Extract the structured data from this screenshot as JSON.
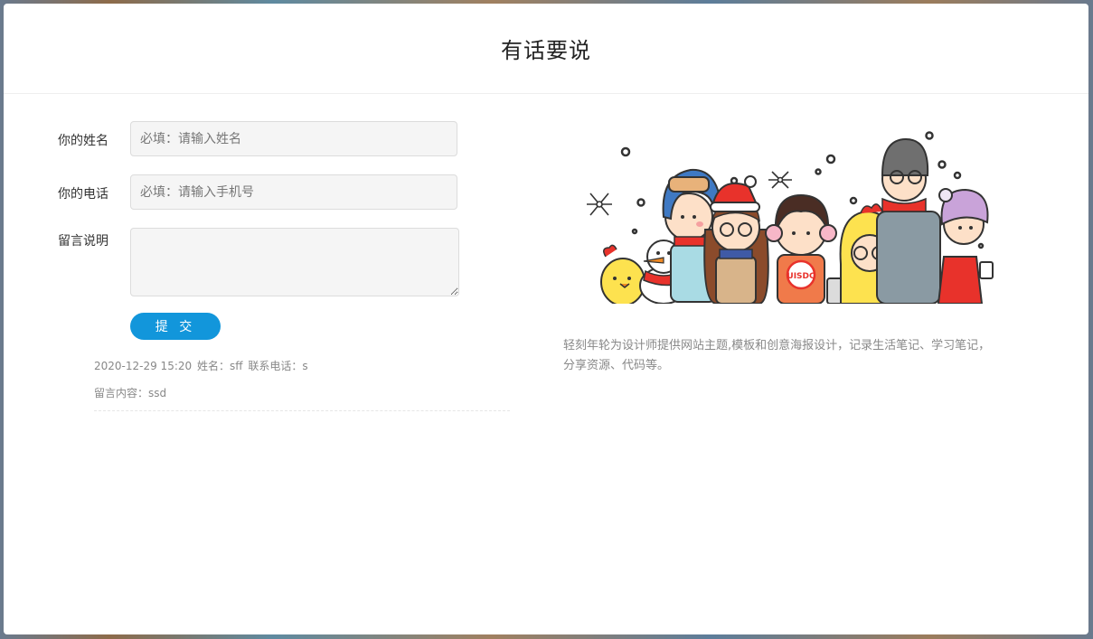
{
  "modal": {
    "title": "有话要说"
  },
  "form": {
    "name": {
      "label": "你的姓名",
      "placeholder": "必填：请输入姓名",
      "value": ""
    },
    "phone": {
      "label": "你的电话",
      "placeholder": "必填：请输入手机号",
      "value": ""
    },
    "message": {
      "label": "留言说明",
      "value": ""
    },
    "submit_label": "提 交"
  },
  "messages": [
    {
      "datetime": "2020-12-29 15:20",
      "name_label": "姓名：",
      "name": "sff",
      "phone_label": "联系电话：",
      "phone": "s",
      "content_label": "留言内容：",
      "content": "ssd"
    }
  ],
  "description": "轻刻年轮为设计师提供网站主题,模板和创意海报设计，记录生活笔记、学习笔记，分享资源、代码等。",
  "illustration": {
    "badge_text": "UISDC"
  },
  "colors": {
    "accent": "#1296db",
    "input_bg": "#f5f5f5",
    "text_muted": "#888888"
  }
}
